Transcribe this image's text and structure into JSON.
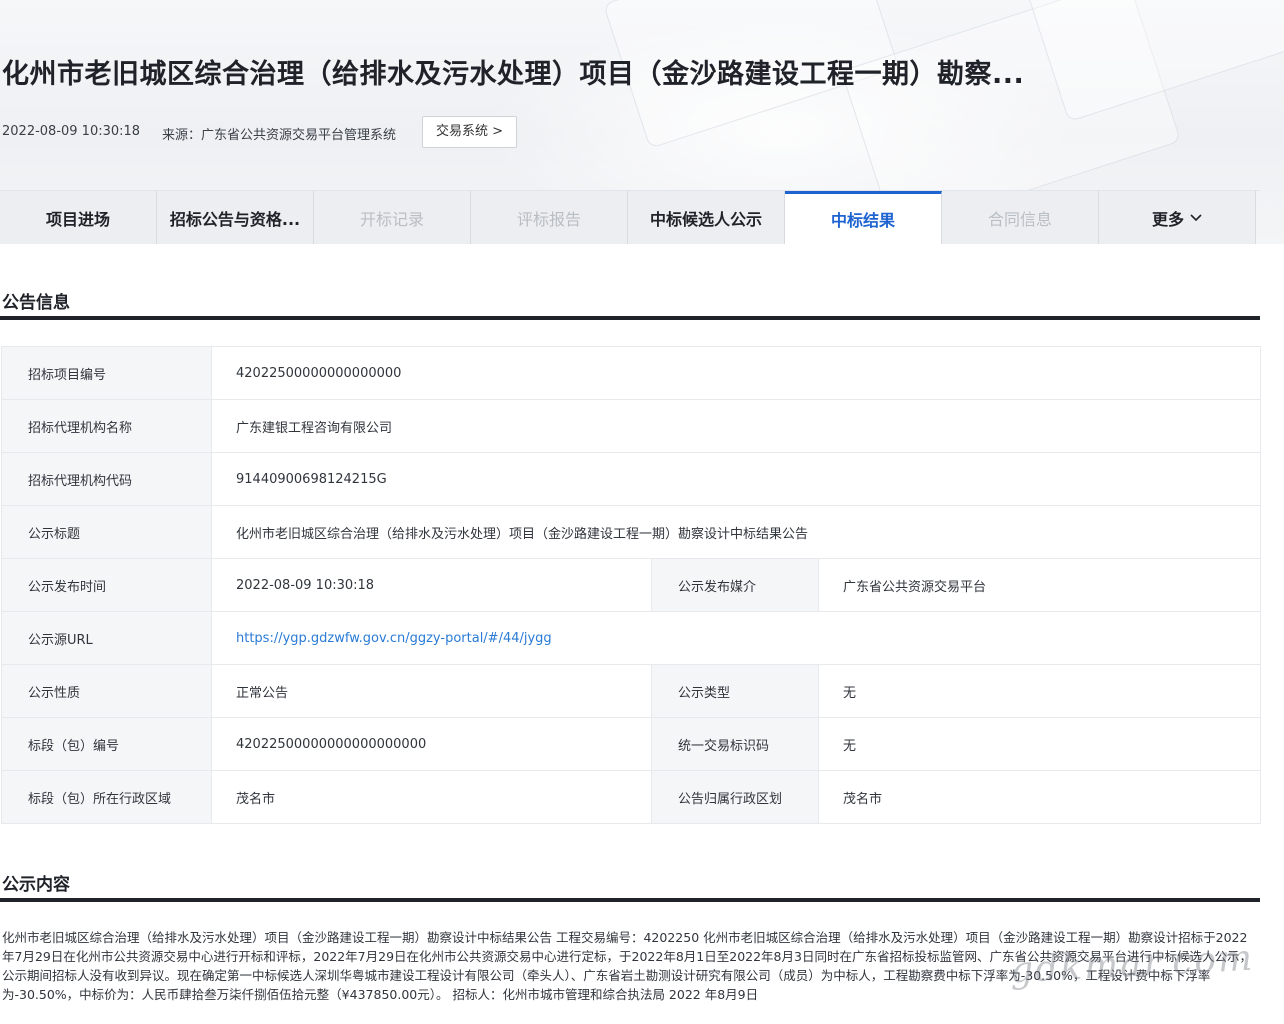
{
  "header": {
    "title": "化州市老旧城区综合治理（给排水及污水处理）项目（金沙路建设工程一期）勘察...",
    "datetime": "2022-08-09 10:30:18",
    "source": "来源：广东省公共资源交易平台管理系统",
    "trade_button": "交易系统 >"
  },
  "tabs": [
    {
      "label": "项目进场",
      "state": "normal"
    },
    {
      "label": "招标公告与资格...",
      "state": "normal"
    },
    {
      "label": "开标记录",
      "state": "disabled"
    },
    {
      "label": "评标报告",
      "state": "disabled"
    },
    {
      "label": "中标候选人公示",
      "state": "normal"
    },
    {
      "label": "中标结果",
      "state": "active"
    },
    {
      "label": "合同信息",
      "state": "disabled"
    },
    {
      "label": "更多",
      "state": "normal"
    }
  ],
  "info_section": {
    "title": "公告信息",
    "rows": [
      {
        "label": "招标项目编号",
        "value": "42022500000000000000"
      },
      {
        "label": "招标代理机构名称",
        "value": "广东建银工程咨询有限公司"
      },
      {
        "label": "招标代理机构代码",
        "value": "91440900698124215G"
      },
      {
        "label": "公示标题",
        "value": "化州市老旧城区综合治理（给排水及污水处理）项目（金沙路建设工程一期）勘察设计中标结果公告"
      },
      {
        "label": "公示发布时间",
        "value": "2022-08-09 10:30:18",
        "label2": "公示发布媒介",
        "value2": "广东省公共资源交易平台"
      },
      {
        "label": "公示源URL",
        "value": "https://ygp.gdzwfw.gov.cn/ggzy-portal/#/44/jygg"
      },
      {
        "label": "公示性质",
        "value": "正常公告",
        "label2": "公示类型",
        "value2": "无"
      },
      {
        "label": "标段（包）编号",
        "value": "42022500000000000000000",
        "label2": "统一交易标识码",
        "value2": "无"
      },
      {
        "label": "标段（包）所在行政区域",
        "value": "茂名市",
        "label2": "公告归属行政区划",
        "value2": "茂名市"
      }
    ]
  },
  "content_section": {
    "title": "公示内容",
    "body": "化州市老旧城区综合治理（给排水及污水处理）项目（金沙路建设工程一期）勘察设计中标结果公告 工程交易编号：4202250 化州市老旧城区综合治理（给排水及污水处理）项目（金沙路建设工程一期）勘察设计招标于2022年7月29日在化州市公共资源交易中心进行开标和评标，2022年7月29日在化州市公共资源交易中心进行定标，于2022年8月1日至2022年8月3日同时在广东省招标投标监管网、广东省公共资源交易平台进行中标候选人公示，公示期间招标人没有收到异议。现在确定第一中标候选人深圳华粤城市建设工程设计有限公司（牵头人）、广东省岩土勘测设计研究有限公司（成员）为中标人，工程勘察费中标下浮率为-30.50%，工程设计费中标下浮率为-30.50%，中标价为：人民币肆拾叁万柒仟捌佰伍拾元整（¥437850.00元）。 招标人：化州市城市管理和综合执法局 2022 年8月9日"
  },
  "watermark": "gdkmar.com"
}
